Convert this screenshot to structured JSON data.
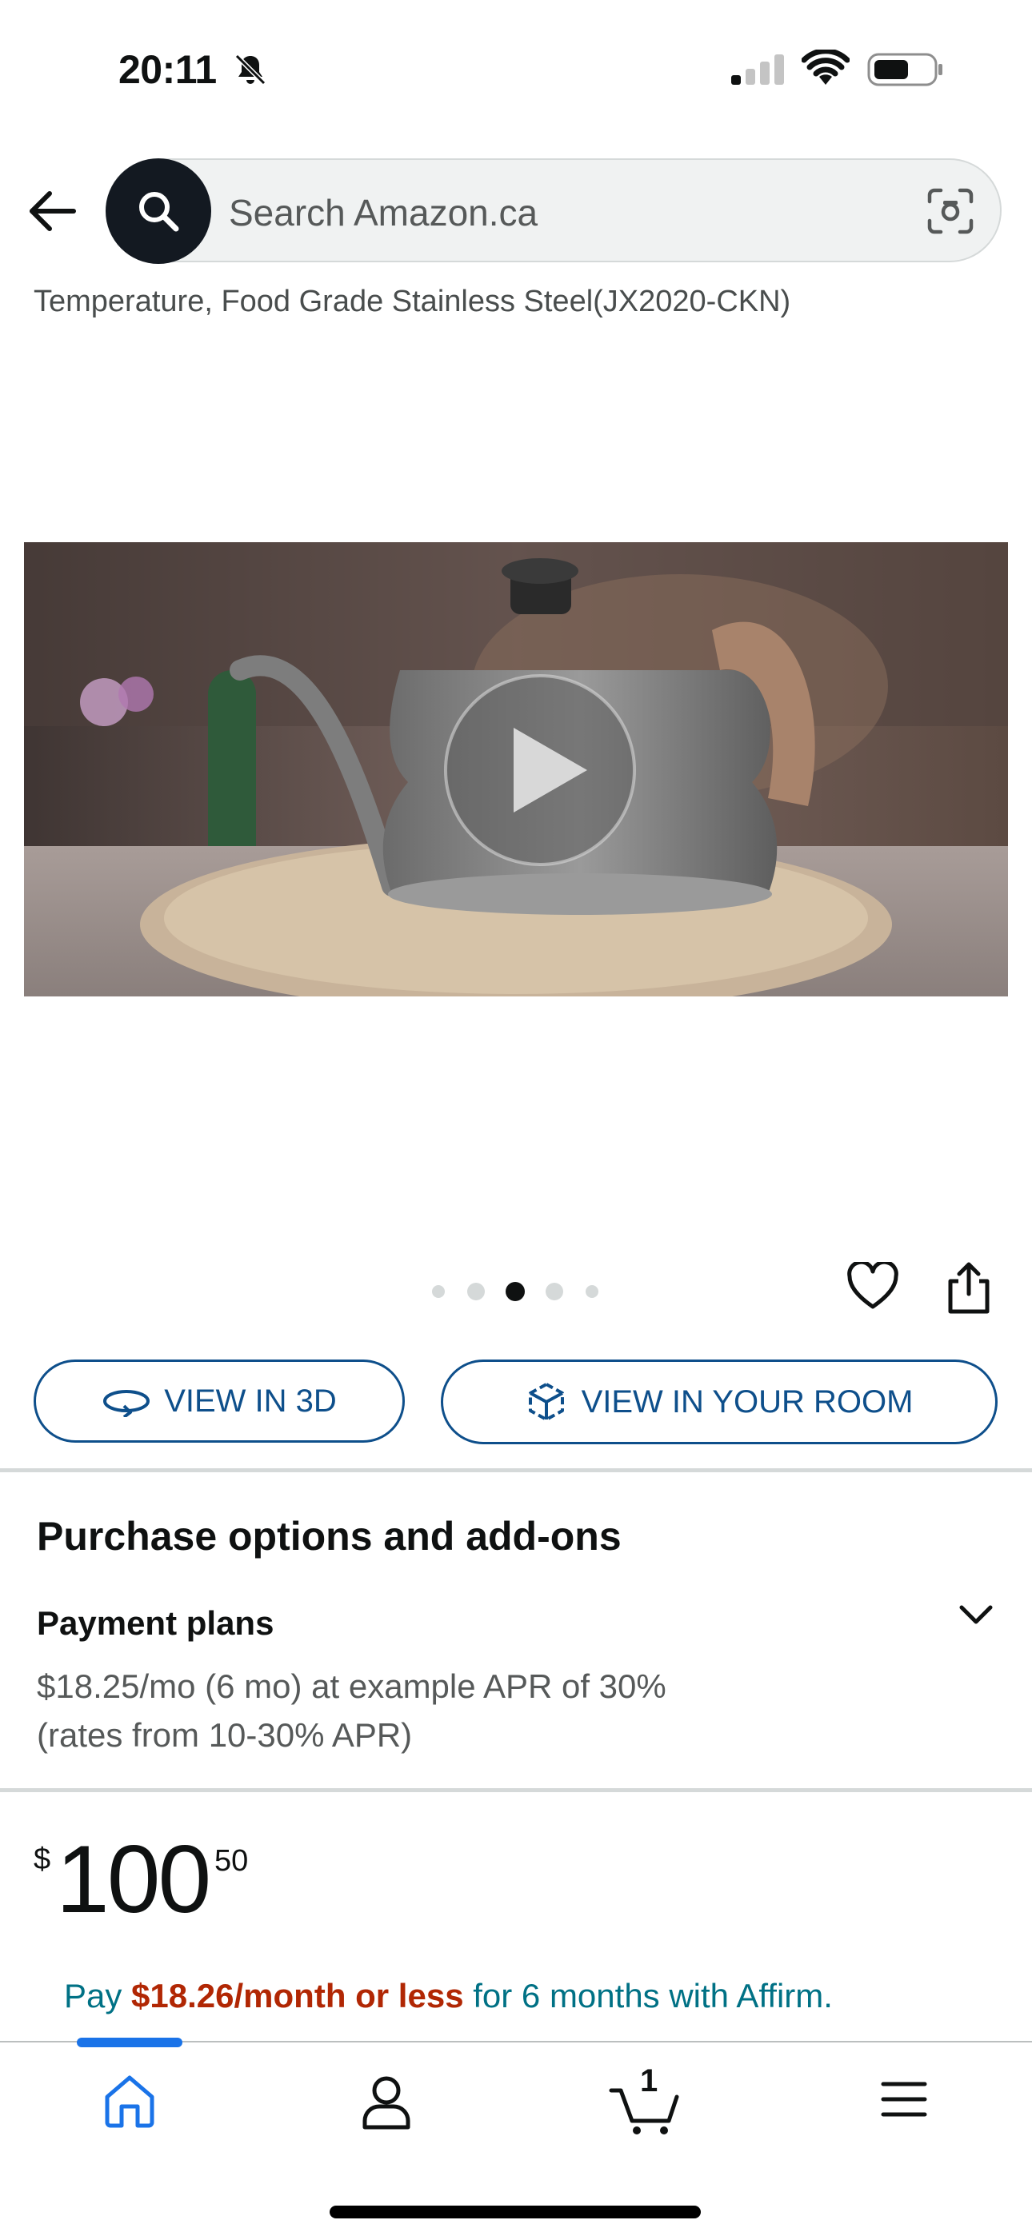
{
  "status_bar": {
    "time": "20:11",
    "icons": [
      "bell-slash-icon",
      "cellular-signal-icon",
      "wifi-icon",
      "battery-icon"
    ]
  },
  "header": {
    "back_icon": "back-arrow-icon",
    "search": {
      "placeholder": "Search Amazon.ca",
      "value": ""
    },
    "camera_icon": "camera-scan-icon"
  },
  "product": {
    "title_fragment": "Temperature, Food Grade Stainless Steel(JX2020-CKN)",
    "media": {
      "type": "video",
      "play_icon": "play-icon",
      "gallery_dots": 5,
      "active_dot_index": 2
    }
  },
  "actions": {
    "wishlist_icon": "heart-icon",
    "share_icon": "share-icon",
    "view_3d_label": "VIEW IN 3D",
    "view_room_label": "VIEW IN YOUR ROOM"
  },
  "purchase_options": {
    "title": "Purchase options and add-ons",
    "payment_plans": {
      "title": "Payment plans",
      "detail_line1": "$18.25/mo (6 mo) at example APR of 30%",
      "detail_line2": "(rates from 10-30% APR)"
    }
  },
  "price": {
    "symbol": "$",
    "whole": "100",
    "fraction": "50"
  },
  "affirm": {
    "prefix": "Pay ",
    "amount": "$18.26/month or less",
    "suffix": " for 6 months with Affirm."
  },
  "bottom_nav": {
    "items": [
      "home-icon",
      "account-icon",
      "cart-icon",
      "menu-icon"
    ],
    "active": "home",
    "cart_count": "1"
  },
  "colors": {
    "link_blue": "#0e4f8b",
    "affirm_teal": "#007185",
    "affirm_red": "#b12704",
    "nav_active": "#1a73e8",
    "search_dark": "#131921"
  }
}
